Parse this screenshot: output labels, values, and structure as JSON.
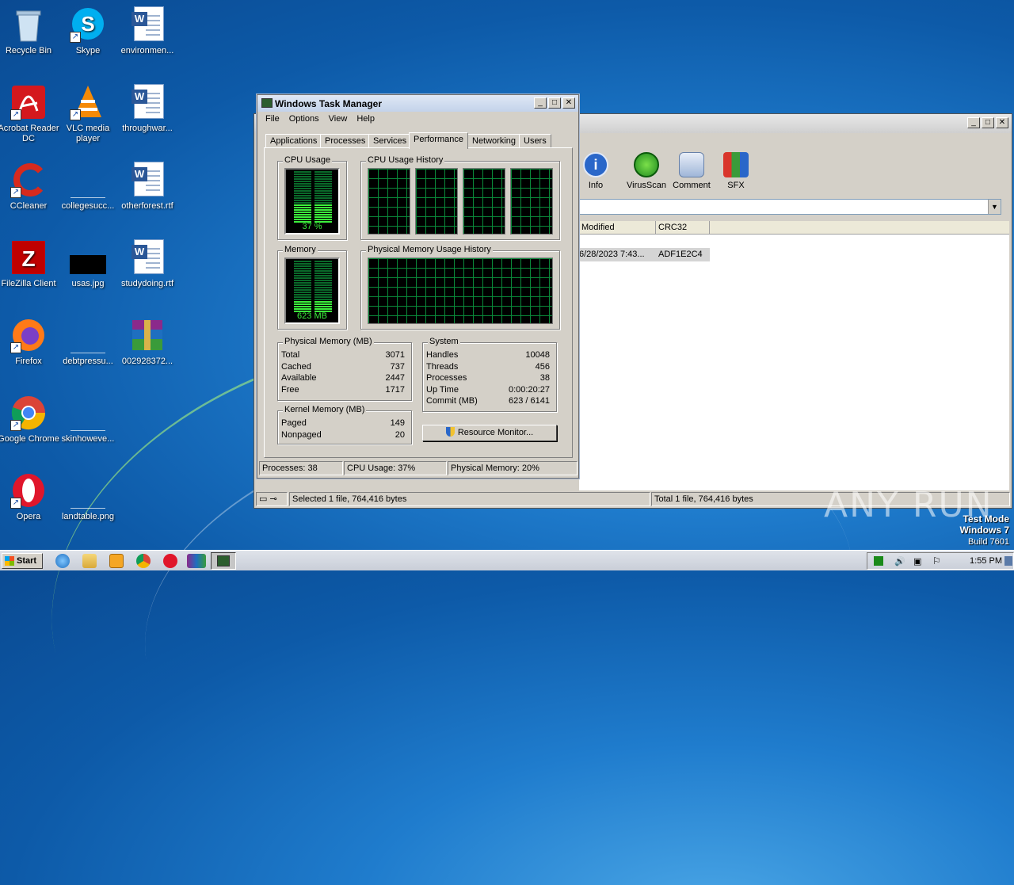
{
  "desktop": {
    "icons": [
      {
        "label": "Recycle Bin"
      },
      {
        "label": "Skype"
      },
      {
        "label": "environmen..."
      },
      {
        "label": "Acrobat Reader DC"
      },
      {
        "label": "VLC media player"
      },
      {
        "label": "throughwar..."
      },
      {
        "label": "CCleaner"
      },
      {
        "label": "collegesucc..."
      },
      {
        "label": "otherforest.rtf"
      },
      {
        "label": "FileZilla Client"
      },
      {
        "label": "usas.jpg"
      },
      {
        "label": "studydoing.rtf"
      },
      {
        "label": "Firefox"
      },
      {
        "label": "debtpressu..."
      },
      {
        "label": "002928372..."
      },
      {
        "label": "Google Chrome"
      },
      {
        "label": "skinhoweve..."
      },
      {
        "label": "Opera"
      },
      {
        "label": "landtable.png"
      }
    ]
  },
  "archiver": {
    "toolbar": [
      {
        "label": "Info",
        "icon": "info-icon"
      },
      {
        "label": "VirusScan",
        "icon": "virusscan-icon"
      },
      {
        "label": "Comment",
        "icon": "comment-icon"
      },
      {
        "label": "SFX",
        "icon": "sfx-icon"
      }
    ],
    "columns": [
      "Modified",
      "CRC32"
    ],
    "rows": [
      {
        "modified": "6/28/2023 7:43...",
        "crc32": "ADF1E2C4"
      }
    ],
    "status_left": "Selected 1 file, 764,416 bytes",
    "status_right": "Total 1 file, 764,416 bytes"
  },
  "taskmgr": {
    "title": "Windows Task Manager",
    "menu": [
      "File",
      "Options",
      "View",
      "Help"
    ],
    "tabs": [
      "Applications",
      "Processes",
      "Services",
      "Performance",
      "Networking",
      "Users"
    ],
    "active_tab": "Performance",
    "cpu_usage_label": "CPU Usage",
    "cpu_usage_value": "37 %",
    "cpu_usage_fraction": 0.37,
    "cpu_history_label": "CPU Usage History",
    "memory_label": "Memory",
    "memory_value": "623 MB",
    "memory_fraction": 0.2,
    "phys_history_label": "Physical Memory Usage History",
    "physical_memory": {
      "title": "Physical Memory (MB)",
      "rows": [
        {
          "k": "Total",
          "v": "3071"
        },
        {
          "k": "Cached",
          "v": "737"
        },
        {
          "k": "Available",
          "v": "2447"
        },
        {
          "k": "Free",
          "v": "1717"
        }
      ]
    },
    "kernel_memory": {
      "title": "Kernel Memory (MB)",
      "rows": [
        {
          "k": "Paged",
          "v": "149"
        },
        {
          "k": "Nonpaged",
          "v": "20"
        }
      ]
    },
    "system": {
      "title": "System",
      "rows": [
        {
          "k": "Handles",
          "v": "10048"
        },
        {
          "k": "Threads",
          "v": "456"
        },
        {
          "k": "Processes",
          "v": "38"
        },
        {
          "k": "Up Time",
          "v": "0:00:20:27"
        },
        {
          "k": "Commit (MB)",
          "v": "623 / 6141"
        }
      ]
    },
    "resource_monitor_button": "Resource Monitor...",
    "status": {
      "processes": "Processes: 38",
      "cpu": "CPU Usage: 37%",
      "memory": "Physical Memory: 20%"
    }
  },
  "taskbar": {
    "start_label": "Start",
    "clock": "1:55 PM"
  },
  "watermark": {
    "line1": "Test Mode",
    "line2": "Windows 7",
    "line3": "Build 7601",
    "brand": "ANY RUN"
  }
}
